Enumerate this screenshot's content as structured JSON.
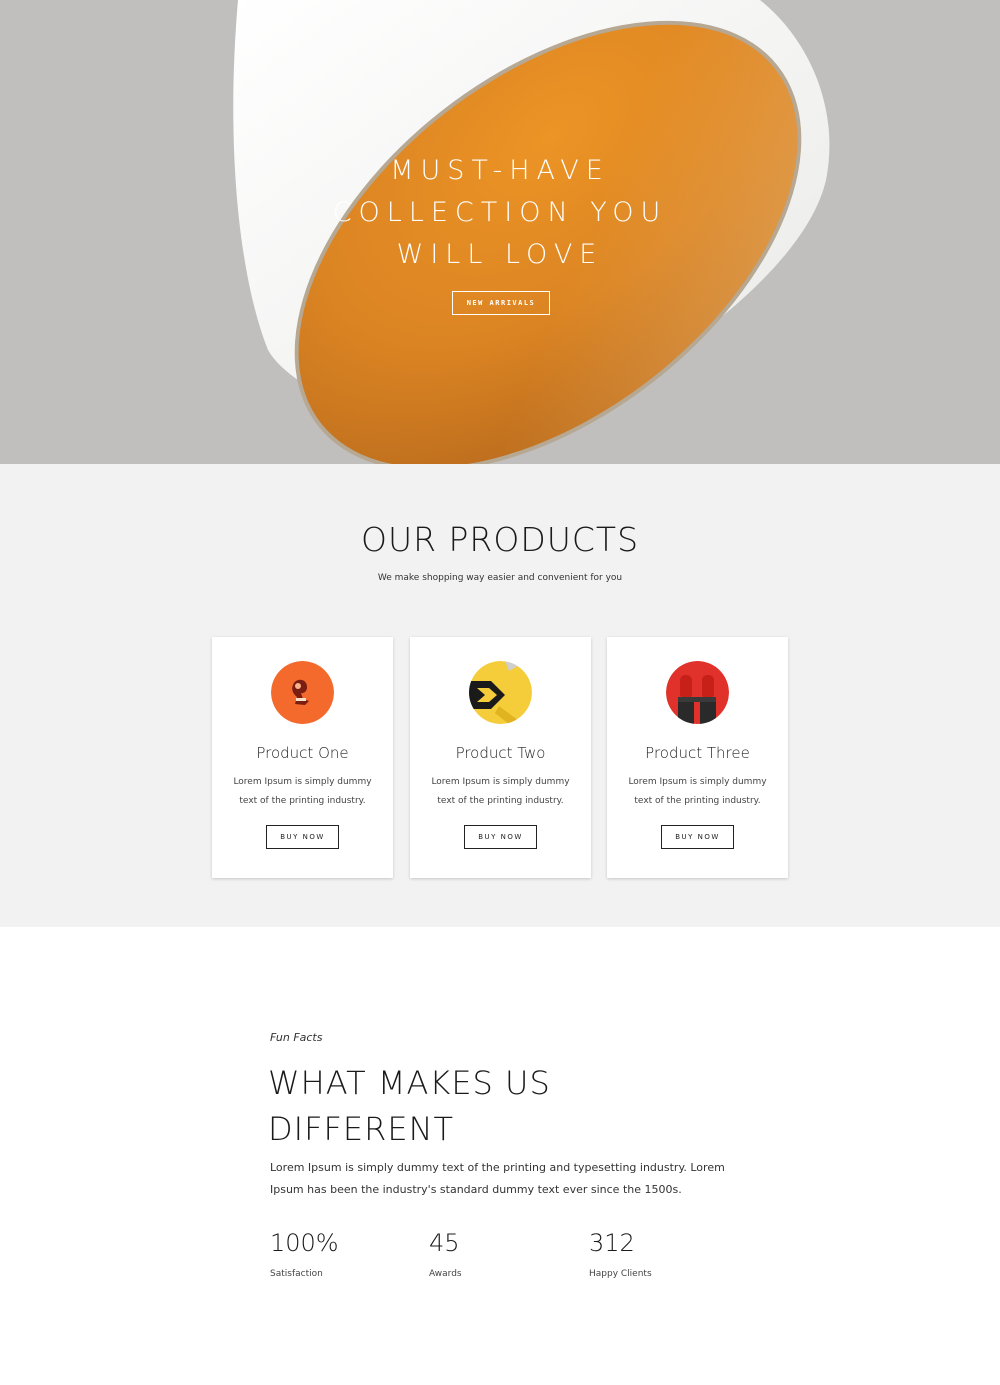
{
  "hero": {
    "title_lines": [
      "MUST-HAVE",
      "COLLECTION YOU",
      "WILL LOVE"
    ],
    "cta_label": "NEW ARRIVALS",
    "colors": {
      "background": "#c0bfbd",
      "lamp_outer": "#f5f5f3",
      "lamp_inner": "#e08a22"
    }
  },
  "products": {
    "title": "OUR PRODUCTS",
    "subtitle": "We make shopping way easier and convenient for you",
    "items": [
      {
        "name": "Product One",
        "description": "Lorem Ipsum is simply dummy text of the printing industry.",
        "button": "BUY NOW",
        "image_color": "#f36a2c"
      },
      {
        "name": "Product Two",
        "description": "Lorem Ipsum is simply dummy text of the printing industry.",
        "button": "BUY NOW",
        "image_color": "#f5cd3a"
      },
      {
        "name": "Product Three",
        "description": "Lorem Ipsum is simply dummy text of the printing industry.",
        "button": "BUY NOW",
        "image_color": "#e0322a"
      }
    ]
  },
  "facts": {
    "kicker": "Fun Facts",
    "title_lines": [
      "WHAT MAKES US",
      "DIFFERENT"
    ],
    "text": "Lorem Ipsum is simply dummy text of the printing and typesetting industry. Lorem Ipsum has been the industry's standard dummy text ever since the 1500s.",
    "stats": [
      {
        "value": "100%",
        "label": "Satisfaction"
      },
      {
        "value": "45",
        "label": "Awards"
      },
      {
        "value": "312",
        "label": "Happy Clients"
      }
    ]
  }
}
